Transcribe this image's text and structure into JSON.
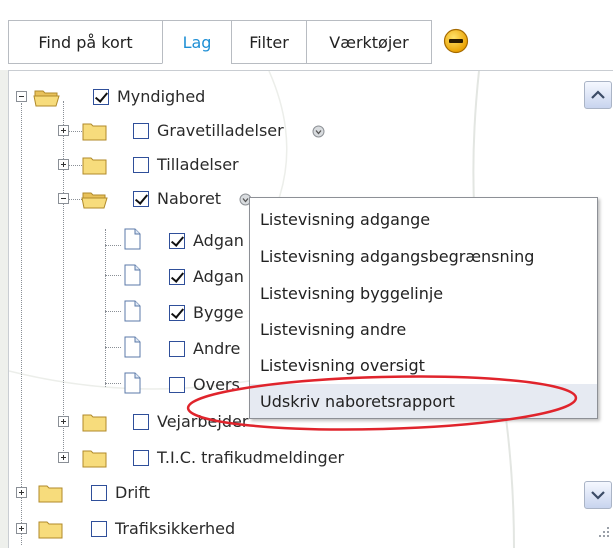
{
  "toolbar": {
    "tabs": [
      {
        "label": "Find på kort",
        "active": false
      },
      {
        "label": "Lag",
        "active": true
      },
      {
        "label": "Filter",
        "active": false
      },
      {
        "label": "Værktøjer",
        "active": false
      }
    ],
    "accent_color": "#1e8fd5"
  },
  "tree": {
    "myndighed": {
      "label": "Myndighed",
      "checked": true,
      "expanded": true
    },
    "gravetilladelser": {
      "label": "Gravetilladelser",
      "checked": false
    },
    "tilladelser": {
      "label": "Tilladelser",
      "checked": false
    },
    "naboret": {
      "label": "Naboret",
      "checked": true,
      "expanded": true
    },
    "naboret_children": [
      {
        "label": "Adgan",
        "checked": true
      },
      {
        "label": "Adgan",
        "checked": true
      },
      {
        "label": "Bygge",
        "checked": true
      },
      {
        "label": "Andre",
        "checked": false
      },
      {
        "label": "Overs",
        "checked": false
      }
    ],
    "vejarbejder": {
      "label": "Vejarbejder",
      "checked": false
    },
    "tic": {
      "label": "T.I.C. trafikudmeldinger",
      "checked": false
    },
    "drift": {
      "label": "Drift",
      "checked": false
    },
    "trafiksikkerhed": {
      "label": "Trafiksikkerhed",
      "checked": false
    }
  },
  "context_menu": {
    "items": [
      "Listevisning adgange",
      "Listevisning adgangsbegrænsning",
      "Listevisning byggelinje",
      "Listevisning andre",
      "Listevisning oversigt",
      "Udskriv naboretsrapport"
    ],
    "highlighted_index": 5,
    "annotation_color": "#e0242c"
  }
}
